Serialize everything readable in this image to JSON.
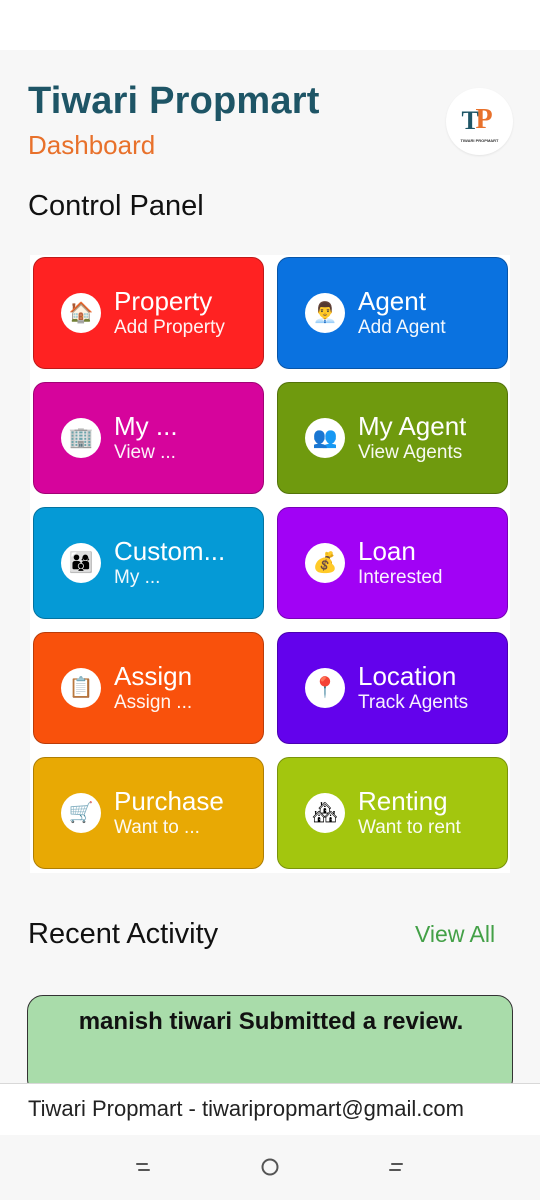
{
  "header": {
    "title": "Tiwari Propmart",
    "subtitle": "Dashboard",
    "logo": {
      "mark_left": "T",
      "mark_right": "P",
      "text": "TIWARI PROPMART"
    }
  },
  "control_panel": {
    "title": "Control Panel",
    "cards": [
      {
        "title": "Property",
        "subtitle": "Add Property",
        "color": "#ff2222",
        "icon": "home-icon",
        "glyph": "🏠"
      },
      {
        "title": "Agent",
        "subtitle": "Add Agent",
        "color": "#0a72e0",
        "icon": "agent-icon",
        "glyph": "👨‍💼"
      },
      {
        "title": "My ...",
        "subtitle": "View ...",
        "color": "#d6049c",
        "icon": "building-icon",
        "glyph": "🏢"
      },
      {
        "title": "My Agent",
        "subtitle": "View Agents",
        "color": "#6f9a0e",
        "icon": "group-icon",
        "glyph": "👥"
      },
      {
        "title": "Custom...",
        "subtitle": "My ...",
        "color": "#059ad6",
        "icon": "customers-icon",
        "glyph": "👨‍👩‍👦"
      },
      {
        "title": "Loan",
        "subtitle": "Interested",
        "color": "#a102f5",
        "icon": "loan-icon",
        "glyph": "💰"
      },
      {
        "title": "Assign",
        "subtitle": "Assign ...",
        "color": "#f9510c",
        "icon": "assign-icon",
        "glyph": "📋"
      },
      {
        "title": "Location",
        "subtitle": "Track Agents",
        "color": "#6302ec",
        "icon": "location-pin-icon",
        "glyph": "📍"
      },
      {
        "title": "Purchase",
        "subtitle": "Want to ...",
        "color": "#e8a904",
        "icon": "cart-icon",
        "glyph": "🛒"
      },
      {
        "title": "Renting",
        "subtitle": "Want to rent",
        "color": "#a3c60e",
        "icon": "rent-house-icon",
        "glyph": "🏘"
      }
    ]
  },
  "recent_activity": {
    "title": "Recent Activity",
    "view_all": "View All",
    "items": [
      {
        "text": "manish tiwari Submitted a review."
      }
    ]
  },
  "footer": {
    "text": "Tiwari Propmart - tiwaripropmart@gmail.com"
  }
}
